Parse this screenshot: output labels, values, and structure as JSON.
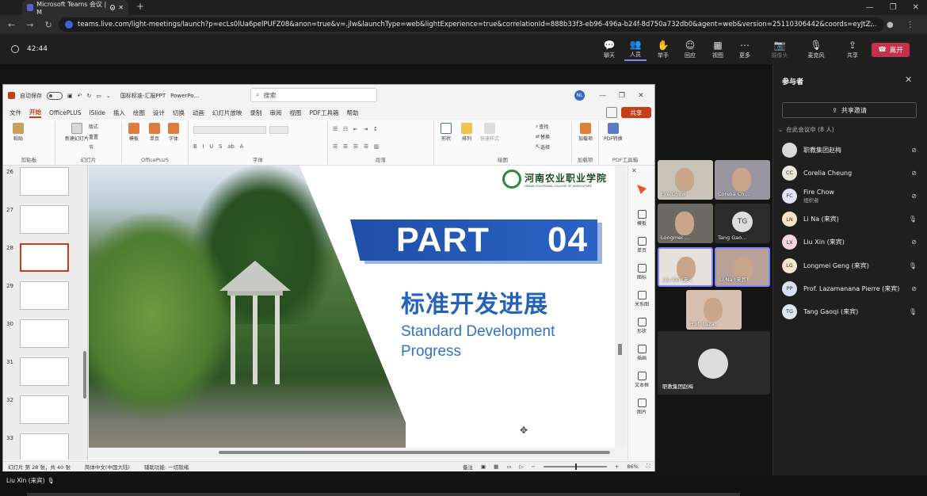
{
  "browser": {
    "tab_title": "Microsoft Teams 会议 | M",
    "url": "teams.live.com/light-meetings/launch?p=ecLs0lUa6pelPUFZ08&anon=true&v=.jlw&launchType=web&lightExperience=true&correlationId=888b33f3-eb96-496a-b24f-8d750a732db0&agent=web&version=25110306442&coords=eyJtZ..."
  },
  "meeting": {
    "timer": "42:44",
    "toolbar": [
      {
        "label": "聊天",
        "icon": "chat-icon"
      },
      {
        "label": "人员",
        "icon": "people-icon"
      },
      {
        "label": "举手",
        "icon": "raise-hand-icon"
      },
      {
        "label": "回应",
        "icon": "react-icon"
      },
      {
        "label": "视图",
        "icon": "view-icon"
      },
      {
        "label": "更多",
        "icon": "more-icon"
      },
      {
        "label": "摄像头",
        "icon": "camera-off-icon"
      },
      {
        "label": "麦克风",
        "icon": "mic-off-icon"
      },
      {
        "label": "共享",
        "icon": "share-icon"
      }
    ],
    "leave_label": "离开"
  },
  "ppt": {
    "autosave": "自动保存",
    "filename": "国标标准-汇报PPT",
    "app": "PowerPo...",
    "search_placeholder": "搜索",
    "avatar": "NL",
    "share": "共享",
    "tabs": [
      "文件",
      "开始",
      "OfficePLUS",
      "iSlide",
      "插入",
      "绘图",
      "设计",
      "切换",
      "动画",
      "幻灯片放映",
      "录制",
      "审阅",
      "视图",
      "PDF工具箱",
      "帮助"
    ],
    "selected_tab": "开始",
    "ribbon_groups": [
      "剪贴板",
      "幻灯片",
      "OfficePLUS",
      "字体",
      "段落",
      "绘图",
      "加载项",
      "PDF工具箱"
    ],
    "ribbon_tools": {
      "paste": "粘贴",
      "new_slide": "新建幻灯片",
      "layout": "版式",
      "reset": "重置",
      "section": "节",
      "template": "模板",
      "single_page": "单页",
      "font_tool": "字体",
      "shapes": "形状",
      "arrange": "排列",
      "quick_styles": "快速样式",
      "find": "查找",
      "replace": "替换",
      "select": "选择",
      "addins": "加载项",
      "pdf_convert": "PDF转换"
    },
    "slide_numbers": [
      "26",
      "27",
      "28",
      "29",
      "30",
      "31",
      "32",
      "33"
    ],
    "selected_slide": "28",
    "slide": {
      "logo_cn": "河南农业职业学院",
      "logo_en": "HENAN VOCATIONAL COLLEGE OF AGRICULTURE",
      "part": "PART",
      "part_num": "04",
      "title_cn": "标准开发进展",
      "title_en_1": "Standard Development",
      "title_en_2": "Progress"
    },
    "right_pane": [
      "模板",
      "单页",
      "图标",
      "关系图",
      "形状",
      "插画",
      "文本框",
      "图片"
    ],
    "status": {
      "slide_info": "幻灯片 第 28 张，共 40 张",
      "language": "简体中文(中国大陆)",
      "accessibility": "辅助功能: 一切就绪",
      "notes": "备注",
      "zoom": "86%"
    }
  },
  "tiles": [
    {
      "name": "Fire Chow"
    },
    {
      "name": "Corelia Ch..."
    },
    {
      "name": "Longmei ..."
    },
    {
      "name": "Tang Gao...",
      "initials": "TG"
    },
    {
      "name": "Liu Xin (来..."
    },
    {
      "name": "Li Na (来宾)"
    },
    {
      "name": "Prof. Laza..."
    }
  ],
  "self_tile_name": "职教集团赵梅",
  "participants_panel": {
    "title": "参与者",
    "invite": "共享邀请",
    "in_meeting": "在此会议中 (8 人)",
    "list": [
      {
        "name": "职教集团赵梅",
        "initials": "",
        "role": "",
        "color": "#d9d9d9"
      },
      {
        "name": "Corelia Cheung",
        "initials": "CC",
        "role": "",
        "color": "#e8e6d6"
      },
      {
        "name": "Fire Chow",
        "initials": "FC",
        "role": "组织者",
        "color": "#e0e3f5"
      },
      {
        "name": "Li Na (来宾)",
        "initials": "LN",
        "role": "",
        "color": "#f5e4c4"
      },
      {
        "name": "Liu Xin (来宾)",
        "initials": "LX",
        "role": "",
        "color": "#f5d6df"
      },
      {
        "name": "Longmei Geng (来宾)",
        "initials": "LG",
        "role": "",
        "color": "#f5e6cf"
      },
      {
        "name": "Prof. Lazamanana Pierre (来宾)",
        "initials": "PP",
        "role": "",
        "color": "#d8e1f2"
      },
      {
        "name": "Tang Gaoqi (来宾)",
        "initials": "TG",
        "role": "",
        "color": "#dfe6ee"
      }
    ]
  },
  "bottom_speaker": "Liu Xin (来宾)"
}
